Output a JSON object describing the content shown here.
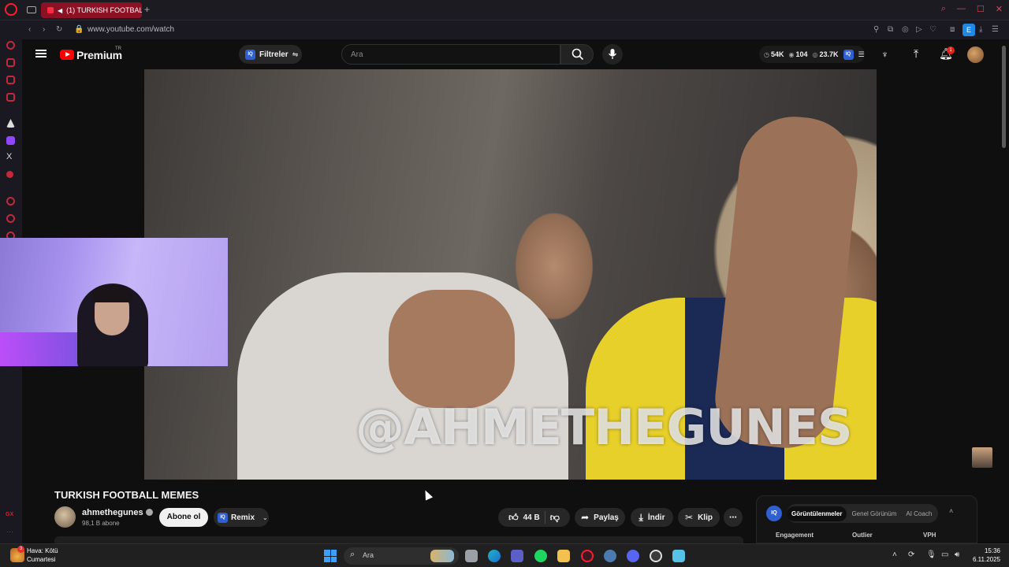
{
  "browser": {
    "tab_title": "(1) TURKISH FOOTBAL",
    "url": "www.youtube.com/watch",
    "extension_badge": "E"
  },
  "youtube_header": {
    "logo_text": "Premium",
    "region": "TR",
    "filters_label": "Filtreler",
    "search_placeholder": "Ara",
    "stats": {
      "views": "54K",
      "likes": "104",
      "watching": "23.7K"
    },
    "notification_count": "1"
  },
  "video": {
    "watermark": "@AHMETHEGUNES",
    "title": "TURKISH FOOTBALL MEMES"
  },
  "channel": {
    "name": "ahmethegunes",
    "subscribers": "98,1 B abone",
    "subscribe_label": "Abone ol",
    "remix_label": "Remix"
  },
  "actions": {
    "like_count": "44 B",
    "share_label": "Paylaş",
    "download_label": "İndir",
    "clip_label": "Klip"
  },
  "side_panel": {
    "tabs": [
      "Görüntülenmeler",
      "Genel Görünüm",
      "AI Coach"
    ],
    "active_tab": 0,
    "columns": [
      "Engagement",
      "Outlier",
      "VPH"
    ]
  },
  "taskbar": {
    "weather_line1": "Hava: Kötü",
    "weather_line2": "Cumartesi",
    "weather_badge": "3",
    "search_placeholder": "Ara",
    "time": "15:36",
    "date": "6.11.2025"
  },
  "colors": {
    "accent_red": "#ff0000",
    "opera_red": "#ff1b2d",
    "iq_blue": "#2f5fd0"
  }
}
